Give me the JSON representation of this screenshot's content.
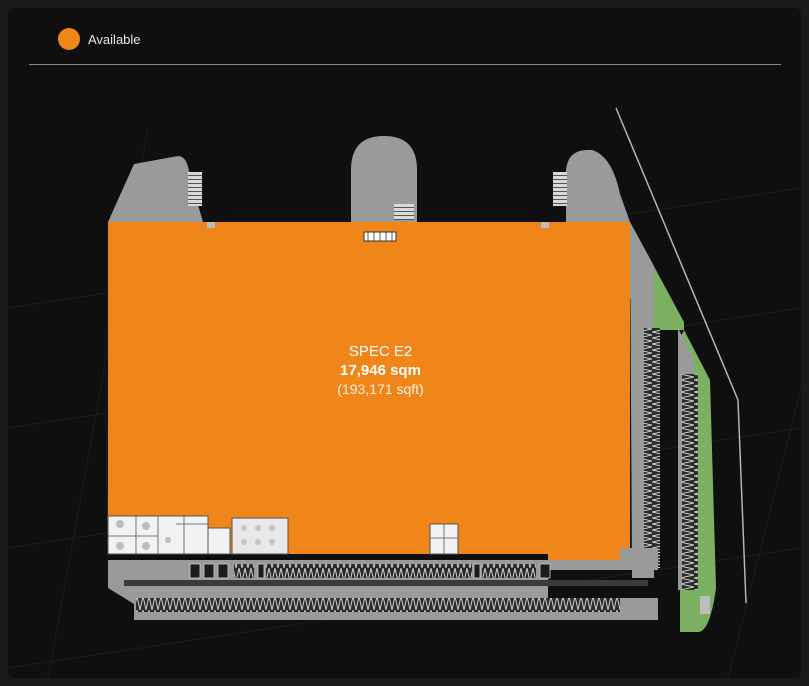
{
  "legend": {
    "items": [
      {
        "label": "Available",
        "color": "#f0861a"
      }
    ]
  },
  "unit": {
    "name": "SPEC E2",
    "area_sqm": "17,946 sqm",
    "area_sqft": "(193,171 sqft)",
    "status": "Available"
  },
  "colors": {
    "available": "#f0861a",
    "building": "#9a9a9a",
    "landscape": "#7cb061",
    "background": "#0f0f0f"
  }
}
